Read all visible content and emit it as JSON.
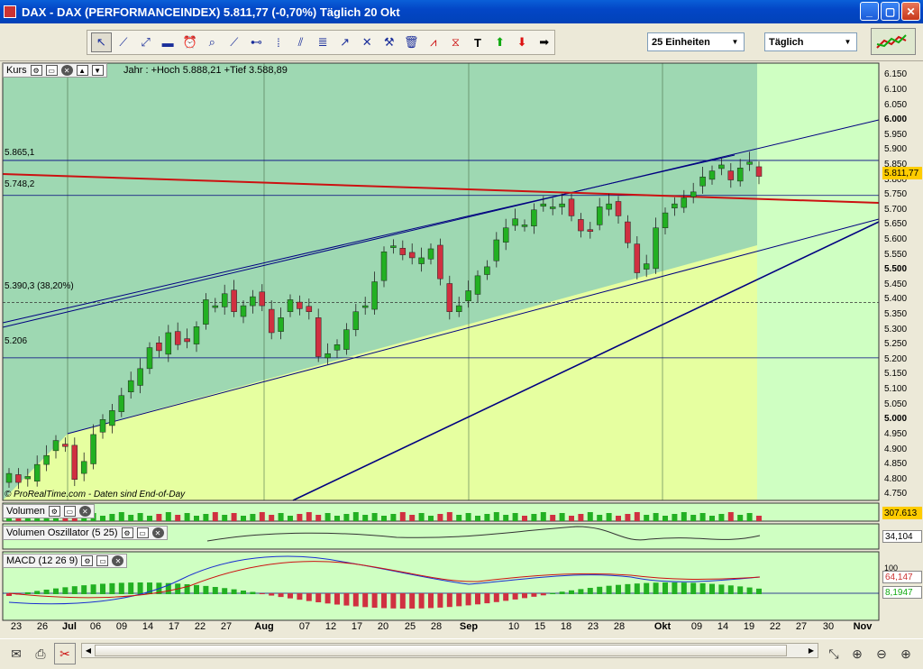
{
  "window": {
    "title": "DAX - DAX (PERFORMANCEINDEX)     5.811,77 (-0,70%)     Täglich  20 Okt",
    "buttons": {
      "minimize": "_",
      "maximize": "▢",
      "close": "✕"
    }
  },
  "toolbar": {
    "tools": [
      "cursor-icon",
      "line-icon",
      "ray-icon",
      "ruler-icon",
      "alarm-icon",
      "zoom-icon",
      "trendline-icon",
      "horizontal-line-icon",
      "vertical-line-icon",
      "parallel-channel-icon",
      "fibonacci-icon",
      "arrow-tool-icon",
      "cross-icon",
      "hammer-icon",
      "trash-icon",
      "pattern-icon",
      "triangle-icon",
      "text-icon",
      "up-arrow-icon",
      "down-arrow-icon",
      "right-arrow-icon"
    ],
    "units_select": "25 Einheiten",
    "period_select": "Täglich"
  },
  "price_panel": {
    "label": "Kurs",
    "info": "Jahr : +Hoch 5.888,21 +Tief 3.588,89",
    "level_labels": [
      "5.865,1",
      "5.748,2",
      "5.390,3 (38,20%)",
      "5.206"
    ],
    "credit": "© ProRealTime.com - Daten sind End-of-Day",
    "y_ticks": [
      "6.150",
      "6.100",
      "6.050",
      "6.000",
      "5.950",
      "5.900",
      "5.850",
      "5.800",
      "5.750",
      "5.700",
      "5.650",
      "5.600",
      "5.550",
      "5.500",
      "5.450",
      "5.400",
      "5.350",
      "5.300",
      "5.250",
      "5.200",
      "5.150",
      "5.100",
      "5.050",
      "5.000",
      "4.950",
      "4.900",
      "4.850",
      "4.800",
      "4.750"
    ],
    "last_price": "5.811,77",
    "colors": {
      "up": "#22b022",
      "down": "#d03040",
      "resistance": "#cc1111",
      "channel": "#000080"
    }
  },
  "volume_panel": {
    "label": "Volumen",
    "value": "307.613"
  },
  "vol_osc_panel": {
    "label": "Volumen Oszillator (5 25)",
    "value": "34,104"
  },
  "macd_panel": {
    "label": "MACD (12 26 9)",
    "value1": "64,147",
    "value2": "8,1947",
    "tick_top": "100"
  },
  "x_axis": [
    "23",
    "26",
    "Jul",
    "06",
    "09",
    "14",
    "17",
    "22",
    "27",
    "Aug",
    "07",
    "12",
    "17",
    "20",
    "25",
    "28",
    "Sep",
    "10",
    "15",
    "18",
    "23",
    "28",
    "Okt",
    "09",
    "14",
    "19",
    "22",
    "27",
    "30",
    "Nov"
  ],
  "chart_data": {
    "type": "candlestick",
    "title": "DAX - DAX (PERFORMANCEINDEX)",
    "period": "Täglich",
    "ylim": [
      4730,
      6190
    ],
    "year_high": 5888.21,
    "year_low": 3588.89,
    "horizontal_levels": [
      5865.1,
      5748.2,
      5390.3,
      5206
    ],
    "candles_close_approx": [
      4820,
      4790,
      4810,
      4850,
      4880,
      4930,
      4910,
      4800,
      4860,
      4950,
      5000,
      5030,
      5080,
      5130,
      5170,
      5240,
      5230,
      5290,
      5250,
      5260,
      5310,
      5400,
      5380,
      5420,
      5360,
      5380,
      5410,
      5380,
      5290,
      5340,
      5400,
      5370,
      5360,
      5210,
      5220,
      5250,
      5300,
      5360,
      5380,
      5460,
      5560,
      5580,
      5550,
      5540,
      5540,
      5570,
      5470,
      5360,
      5380,
      5430,
      5480,
      5510,
      5600,
      5640,
      5670,
      5650,
      5700,
      5720,
      5710,
      5720,
      5680,
      5630,
      5630,
      5710,
      5720,
      5680,
      5590,
      5490,
      5520,
      5640,
      5690,
      5720,
      5740,
      5760,
      5810,
      5830,
      5850,
      5800,
      5840,
      5860,
      5812
    ]
  }
}
